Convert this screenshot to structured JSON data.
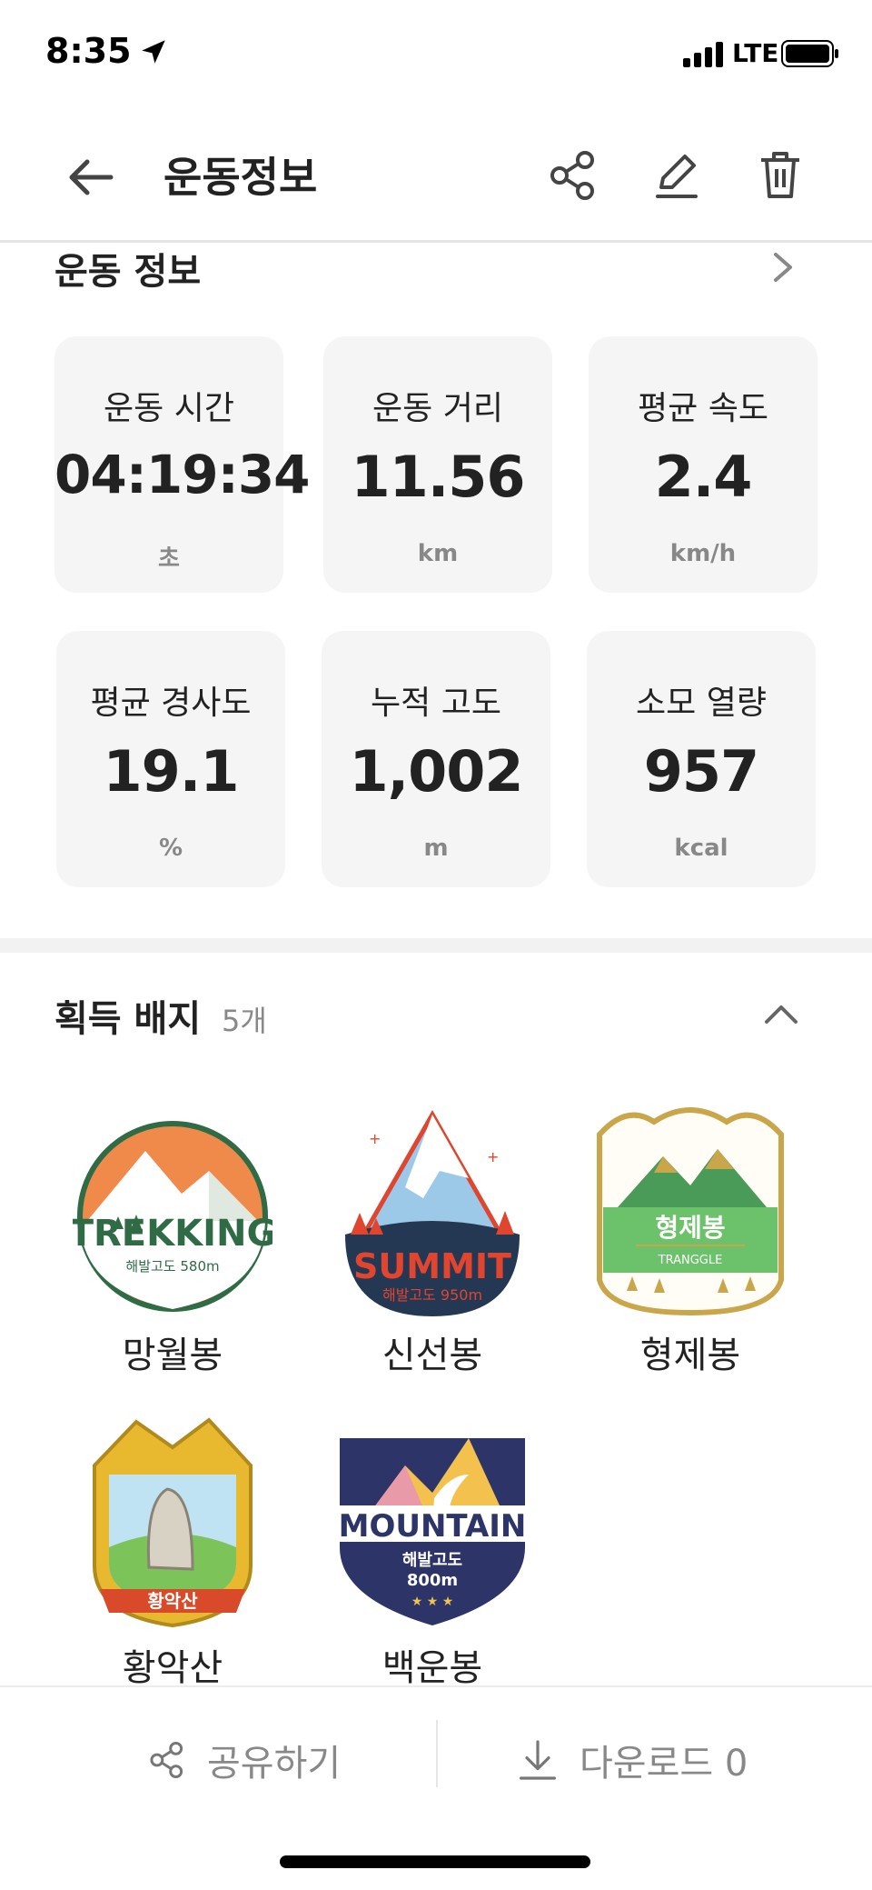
{
  "status_bar": {
    "time": "8:35",
    "network": "LTE"
  },
  "header": {
    "title": "운동정보"
  },
  "workout_section": {
    "title": "운동 정보"
  },
  "stats": [
    {
      "label": "운동 시간",
      "value": "04:19:34",
      "unit": "초"
    },
    {
      "label": "운동 거리",
      "value": "11.56",
      "unit": "km"
    },
    {
      "label": "평균 속도",
      "value": "2.4",
      "unit": "km/h"
    },
    {
      "label": "평균 경사도",
      "value": "19.1",
      "unit": "%"
    },
    {
      "label": "누적 고도",
      "value": "1,002",
      "unit": "m"
    },
    {
      "label": "소모 열량",
      "value": "957",
      "unit": "kcal"
    }
  ],
  "badges_section": {
    "title": "획득 배지",
    "count": "5개"
  },
  "badges": [
    {
      "name": "망월봉",
      "emblem": "TREKKING",
      "sub": "해발고도 580m"
    },
    {
      "name": "신선봉",
      "emblem": "SUMMIT",
      "sub": "해발고도 950m"
    },
    {
      "name": "형제봉",
      "emblem": "형제봉",
      "sub": "TRANGGLE"
    },
    {
      "name": "황악산",
      "emblem": "황악산",
      "sub": "황악산"
    },
    {
      "name": "백운봉",
      "emblem": "MOUNTAIN",
      "sub": "해발고도",
      "sub2": "800m"
    }
  ],
  "bottom_bar": {
    "share_label": "공유하기",
    "download_label": "다운로드 0"
  },
  "colors": {
    "card_bg": "#f5f5f5",
    "text": "#222222",
    "muted": "#888888",
    "trekking": "#2f6b45",
    "summit": "#e0452f",
    "brother": "#6cc26a",
    "mountain": "#2c3468"
  },
  "icons": [
    "location-arrow-icon",
    "signal-icon",
    "battery-icon",
    "back-arrow-icon",
    "share-icon",
    "edit-icon",
    "trash-icon",
    "chevron-right-icon",
    "chevron-up-icon",
    "download-icon"
  ]
}
